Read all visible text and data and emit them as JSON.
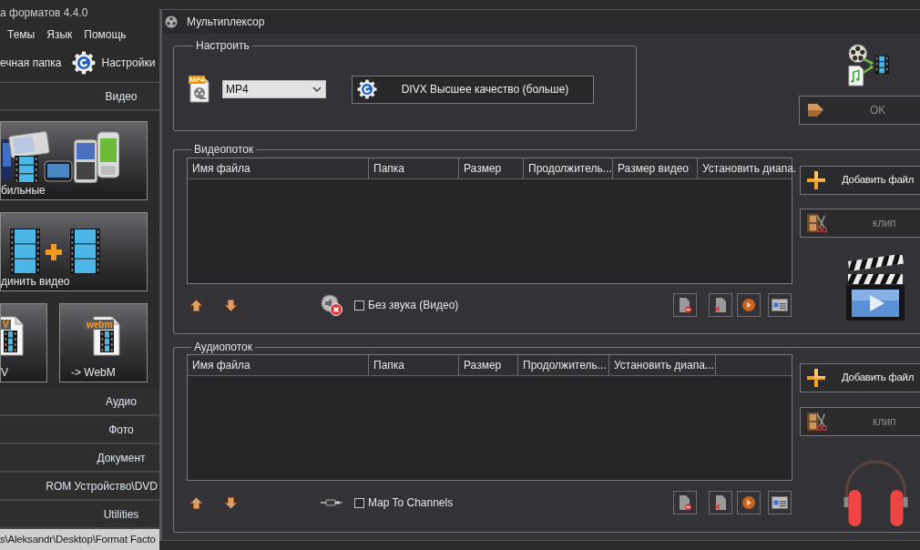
{
  "main_window": {
    "title": "а форматов 4.4.0",
    "menu": [
      "Темы",
      "Язык",
      "Помощь"
    ],
    "toolbar": [
      {
        "kind": "text",
        "label": "ечная папка"
      },
      {
        "kind": "settings",
        "label": "Настройки"
      }
    ],
    "categories": [
      {
        "label": "Видео",
        "tiles": [
          {
            "kind": "mobile",
            "label": "бильные"
          },
          {
            "kind": "join",
            "label": "динить видео"
          },
          {
            "kind": "file",
            "badge": "V",
            "label": "V"
          },
          {
            "kind": "file",
            "badge": "webm",
            "label": "-> WebM"
          }
        ]
      },
      {
        "label": "Аудио"
      },
      {
        "label": "Фото"
      },
      {
        "label": "Документ"
      },
      {
        "label": "ROM Устройство\\DVD"
      },
      {
        "label": "Utilities"
      }
    ],
    "status_bar": "s\\Aleksandr\\Desktop\\Format Facto"
  },
  "dialog": {
    "title": "Мультиплексор",
    "settings": {
      "legend": "Настроить",
      "file_badge": "MP4",
      "format": "MP4",
      "preset_button": "DIVX Высшее качество (больше)"
    },
    "ok_button": {
      "label": "OK",
      "disabled": true
    },
    "streams": [
      {
        "kind": "video",
        "legend": "Видеопоток",
        "columns": [
          "Имя файла",
          "Папка",
          "Размер",
          "Продолжитель...",
          "Размер видео",
          "Установить диапа."
        ],
        "option": {
          "label": "Без звука (Видео)",
          "checked": false
        },
        "add_button": {
          "label": "Добавить файл",
          "disabled": false
        },
        "clip_button": {
          "label": "клип",
          "disabled": true
        }
      },
      {
        "kind": "audio",
        "legend": "Аудиопоток",
        "columns": [
          "Имя файла",
          "Папка",
          "Размер",
          "Продолжитель...",
          "Установить диапа..."
        ],
        "option": {
          "label": "Map To Channels",
          "checked": false
        },
        "add_button": {
          "label": "Добавить файл",
          "disabled": false
        },
        "clip_button": {
          "label": "клип",
          "disabled": true
        }
      }
    ]
  }
}
